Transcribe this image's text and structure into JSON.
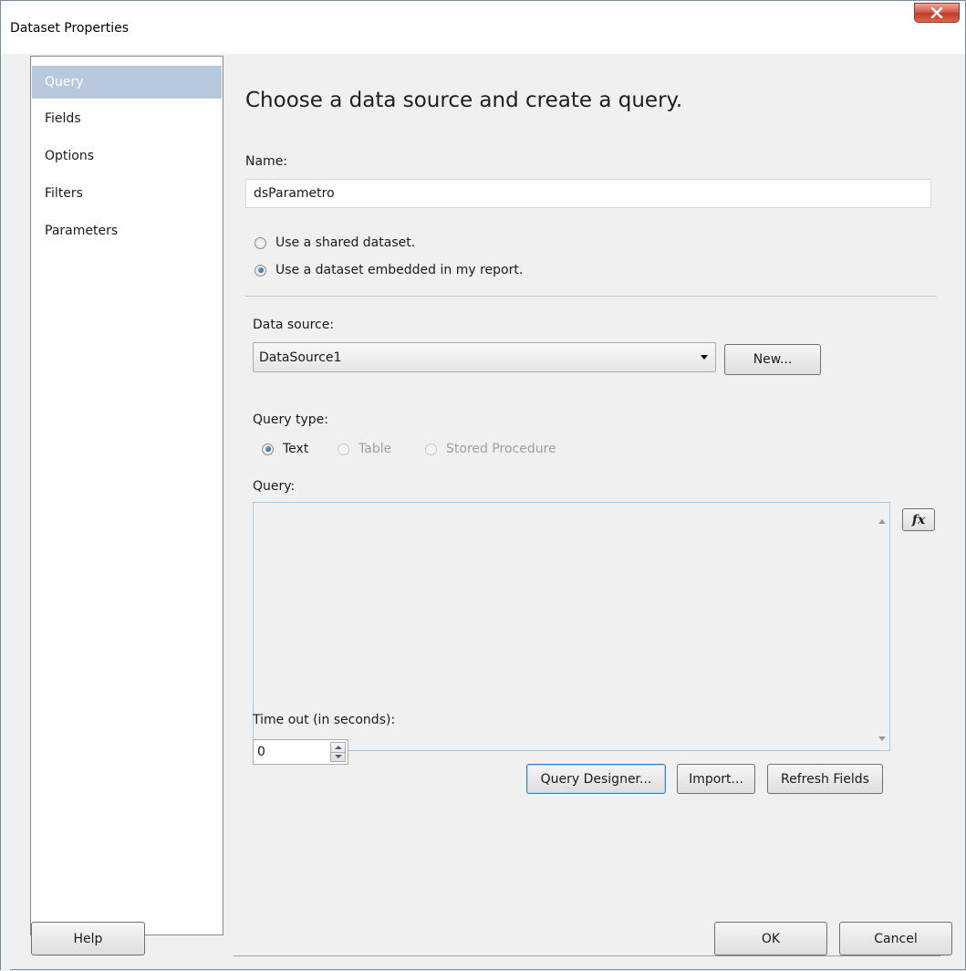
{
  "window": {
    "title": "Dataset Properties"
  },
  "sidebar": {
    "items": [
      {
        "label": "Query",
        "active": true
      },
      {
        "label": "Fields",
        "active": false
      },
      {
        "label": "Options",
        "active": false
      },
      {
        "label": "Filters",
        "active": false
      },
      {
        "label": "Parameters",
        "active": false
      }
    ]
  },
  "main": {
    "heading": "Choose a data source and create a query.",
    "name_label": "Name:",
    "name_value": "dsParametro",
    "radio_shared": "Use a shared dataset.",
    "radio_embedded": "Use a dataset embedded in my report.",
    "data_source_label": "Data source:",
    "data_source_value": "DataSource1",
    "new_button": "New...",
    "query_type_label": "Query type:",
    "query_type_options": [
      "Text",
      "Table",
      "Stored Procedure"
    ],
    "query_type_selected": "Text",
    "query_label": "Query:",
    "query_text": "",
    "fx_label": "fx",
    "query_designer_button": "Query Designer...",
    "import_button": "Import...",
    "refresh_fields_button": "Refresh Fields",
    "timeout_label": "Time out (in seconds):",
    "timeout_value": "0"
  },
  "footer": {
    "help_button": "Help",
    "ok_button": "OK",
    "cancel_button": "Cancel"
  },
  "colors": {
    "active_sidebar": "#b9c9dd",
    "close_button": "#c9452f"
  }
}
